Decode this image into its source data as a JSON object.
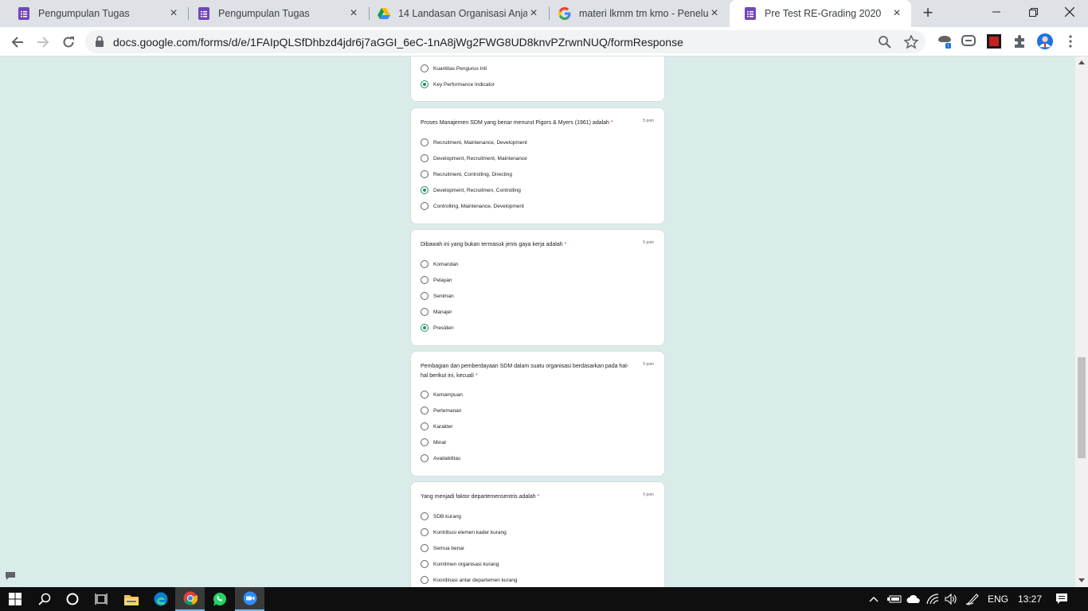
{
  "browser": {
    "tabs": [
      {
        "title": "Pengumpulan Tugas",
        "icon": "google-forms-icon",
        "active": false
      },
      {
        "title": "Pengumpulan Tugas",
        "icon": "google-forms-icon",
        "active": false
      },
      {
        "title": "14 Landasan Organisasi Anjay",
        "icon": "google-drive-icon",
        "active": false
      },
      {
        "title": "materi lkmm tm kmo - Penelus",
        "icon": "google-icon",
        "active": false
      },
      {
        "title": "Pre Test RE-Grading 2020",
        "icon": "google-forms-icon",
        "active": true
      }
    ],
    "url": "docs.google.com/forms/d/e/1FAIpQLSfDhbzd4jdr6j7aGGI_6eC-1nA8jWg2FWG8UD8knvPZrwnNUQ/formResponse"
  },
  "form": {
    "partial_question": {
      "options": [
        {
          "label": "Kuantitas Pengurus Inti",
          "checked": false
        },
        {
          "label": "Key Performance Indicator",
          "checked": true
        }
      ]
    },
    "questions": [
      {
        "title": "Proses Manajemen SDM yang benar menurut Pigors & Myers (1961) adalah",
        "required_mark": "*",
        "points": "5 poin",
        "options": [
          {
            "label": "Recruitment, Maintenance, Development",
            "checked": false
          },
          {
            "label": "Development, Recruitment, Maintenance",
            "checked": false
          },
          {
            "label": "Recruitment, Controlling, Directing",
            "checked": false
          },
          {
            "label": "Development, Recruitmen, Controlling",
            "checked": true
          },
          {
            "label": "Controlling, Maintenance, Development",
            "checked": false
          }
        ]
      },
      {
        "title": "Dibawah ini yang bukan termasuk jenis gaya kerja adalah",
        "required_mark": "*",
        "points": "5 poin",
        "options": [
          {
            "label": "Komandan",
            "checked": false
          },
          {
            "label": "Pelayan",
            "checked": false
          },
          {
            "label": "Seniman",
            "checked": false
          },
          {
            "label": "Manajer",
            "checked": false
          },
          {
            "label": "Presiden",
            "checked": true
          }
        ]
      },
      {
        "title": "Pembagian dan pemberdayaan SDM dalam suatu organisasi berdasarkan pada hal-hal berikut ini, kecuali",
        "required_mark": "*",
        "points": "5 poin",
        "options": [
          {
            "label": "Kemampuan",
            "checked": false
          },
          {
            "label": "Pertemanan",
            "checked": false
          },
          {
            "label": "Karakter",
            "checked": false
          },
          {
            "label": "Minat",
            "checked": false
          },
          {
            "label": "Availabilitas",
            "checked": false
          }
        ]
      },
      {
        "title": "Yang menjadi faktor departemensentris adalah",
        "required_mark": "*",
        "points": "5 poin",
        "options": [
          {
            "label": "SDB kurang",
            "checked": false
          },
          {
            "label": "Kontribusi elemen kader kurang",
            "checked": false
          },
          {
            "label": "Semua benar",
            "checked": false
          },
          {
            "label": "Komitmen organisasi kurang",
            "checked": false
          },
          {
            "label": "Koordinasi antar departemen kurang",
            "checked": false
          }
        ]
      }
    ]
  },
  "taskbar": {
    "language": "ENG",
    "time": "13:27"
  },
  "colors": {
    "page_background": "#d9ecea",
    "accent_radio": "#1e8e6e",
    "required": "#d93025"
  }
}
